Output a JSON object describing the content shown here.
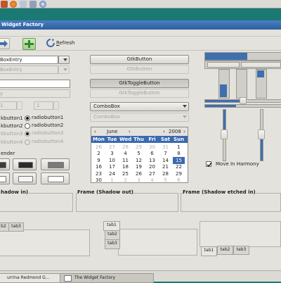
{
  "window": {
    "title": "Widget Factory"
  },
  "toolbar": {
    "refresh_label": "Refresh",
    "refresh_mnemonic": "R",
    "refresh_rest": "efresh"
  },
  "combo_entries": {
    "entry1": "BoxEntry",
    "entry2": "BoxEntry"
  },
  "entries": {
    "entry1": "",
    "entry2": "y"
  },
  "spins": {
    "spin1": "1",
    "spin2": "1"
  },
  "radios": [
    {
      "label": "radiobutton1",
      "checked": true,
      "enabled": true
    },
    {
      "label": "radiobutton2",
      "checked": false,
      "enabled": true
    },
    {
      "label": "radiobutton3",
      "checked": true,
      "enabled": false
    },
    {
      "label": "radiobutton4",
      "checked": false,
      "enabled": false
    }
  ],
  "left_checks": [
    "kbutton1",
    "kbutton2",
    "kbutton3",
    "kbutton4"
  ],
  "render_label": "ender",
  "buttons": {
    "gtkbutton": "GtkButton",
    "gtkbutton_disabled": "GtkButton",
    "toggle": "GtkToggleButton",
    "toggle_disabled": "GtkToggleButton",
    "combobox": "ComboBox",
    "combobox_disabled": "ComboBox"
  },
  "calendar": {
    "month": "June",
    "year": "2008",
    "weekdays": [
      "Mon",
      "Tue",
      "Wed",
      "Thu",
      "Fri",
      "Sat",
      "Sun"
    ],
    "rows": [
      [
        "26",
        "27",
        "28",
        "29",
        "30",
        "31",
        "1"
      ],
      [
        "2",
        "3",
        "4",
        "5",
        "6",
        "7",
        "8"
      ],
      [
        "9",
        "10",
        "11",
        "12",
        "13",
        "14",
        "15"
      ],
      [
        "16",
        "17",
        "18",
        "19",
        "20",
        "21",
        "22"
      ],
      [
        "23",
        "24",
        "25",
        "26",
        "27",
        "28",
        "29"
      ],
      [
        "30",
        "1",
        "2",
        "3",
        "4",
        "5",
        "6"
      ]
    ],
    "selected": "15"
  },
  "move_in_harmony": {
    "label": "Move In Harmony",
    "checked": true
  },
  "frames": {
    "shadow_in": "hadow in)",
    "shadow_out": "Frame (Shadow out)",
    "shadow_etched_in": "Frame (Shadow etched in)"
  },
  "notebooks": {
    "top_tabs": [
      "b2",
      "tab3"
    ],
    "left_tabs": [
      "tab1",
      "tab2",
      "tab3"
    ],
    "bottom_tabs": [
      "tab1",
      "tab2",
      "tab3"
    ]
  },
  "taskbar": [
    {
      "label": "urrina Redmond G...",
      "active": false
    },
    {
      "label": "The Widget Factory",
      "active": true
    }
  ],
  "progress": {
    "horizontal": 0.55,
    "vertical_left": 0.45,
    "vertical_right": 0.0
  },
  "colors": {
    "selection": "#3a6ab0",
    "desktop": "#1a7a73",
    "titlebar": "#3a6db0"
  }
}
